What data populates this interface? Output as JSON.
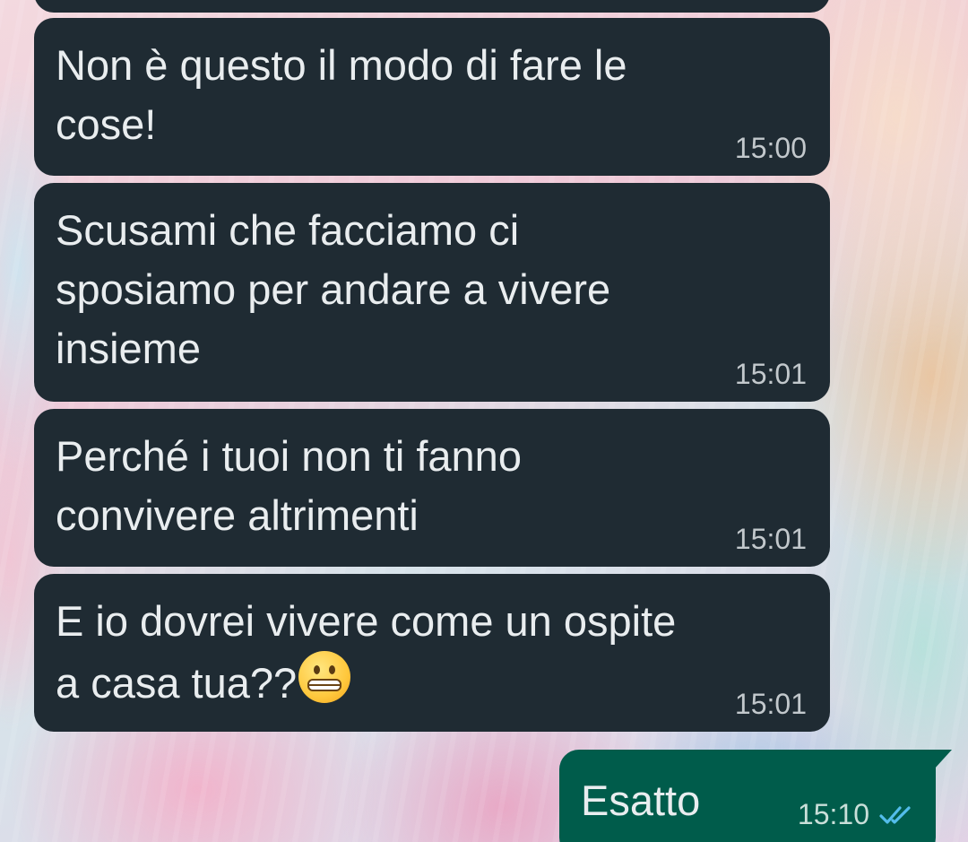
{
  "chat": {
    "messages": [
      {
        "direction": "incoming",
        "text": "Non è questo il modo di fare le\ncose!",
        "time": "15:00"
      },
      {
        "direction": "incoming",
        "text": "Scusami che facciamo ci\nsposiamo per andare a vivere\ninsieme",
        "time": "15:01"
      },
      {
        "direction": "incoming",
        "text": "Perché i tuoi non ti fanno\nconvivere altrimenti",
        "time": "15:01"
      },
      {
        "direction": "incoming",
        "text": "E io dovrei vivere come un ospite\na casa tua??",
        "emoji": "grimacing-face-emoji",
        "time": "15:01"
      },
      {
        "direction": "outgoing",
        "text": "Esatto",
        "time": "15:10",
        "status": "read",
        "status_icon": "double-check-icon"
      }
    ]
  },
  "colors": {
    "incoming_bubble": "#1f2b33",
    "outgoing_bubble": "#005c4b",
    "text": "#e9edef",
    "read_ticks": "#53bdeb"
  }
}
